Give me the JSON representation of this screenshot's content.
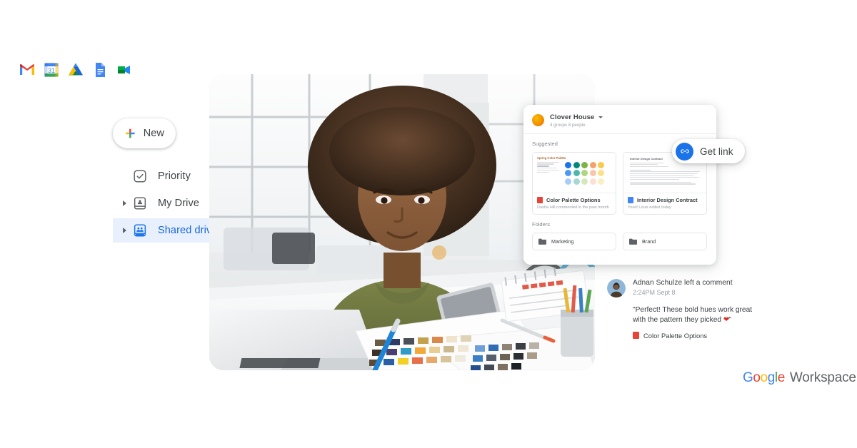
{
  "app_strip": [
    {
      "name": "gmail-icon",
      "label": "Gmail"
    },
    {
      "name": "calendar-icon",
      "label": "Calendar"
    },
    {
      "name": "drive-icon",
      "label": "Drive"
    },
    {
      "name": "docs-icon",
      "label": "Docs"
    },
    {
      "name": "meet-icon",
      "label": "Meet"
    }
  ],
  "sidebar": {
    "new_button": {
      "label": "New",
      "icon": "plus-icon"
    },
    "items": [
      {
        "label": "Priority",
        "icon": "priority-check-icon",
        "active": false,
        "expandable": false
      },
      {
        "label": "My Drive",
        "icon": "my-drive-icon",
        "active": false,
        "expandable": true
      },
      {
        "label": "Shared drives",
        "icon": "shared-drives-icon",
        "active": true,
        "expandable": true
      }
    ],
    "active_bg": "#e8f0fe",
    "active_fg": "#1967d2"
  },
  "drive_card": {
    "title": "Clover House",
    "subtitle": "4 groups  8 people",
    "dropdown_icon": "chevron-down-icon",
    "suggested_label": "Suggested",
    "files": [
      {
        "name": "Color Palette Options",
        "meta": "Dasha Hill commented in the past month",
        "type": "slides",
        "thumb_title": "Spring Color Palette"
      },
      {
        "name": "Interior Design Contract",
        "meta": "Yosef Louis edited today",
        "type": "docs",
        "thumb_title": "Interior Design Contract"
      }
    ],
    "folders_label": "Folders",
    "folders": [
      {
        "name": "Marketing"
      },
      {
        "name": "Brand"
      }
    ],
    "palette_colors": [
      [
        "#1a73e8",
        "#00897b",
        "#7cb342",
        "#f4a26b",
        "#f7cb4d"
      ],
      [
        "#4a9bf0",
        "#4db6ac",
        "#aed581",
        "#f9c6aa",
        "#fbe08a"
      ],
      [
        "#a8cdf7",
        "#a7d7d2",
        "#d4e8b8",
        "#fce0d2",
        "#fdeec2"
      ]
    ]
  },
  "get_link": {
    "label": "Get link",
    "icon": "link-icon",
    "color": "#1a73e8"
  },
  "comment": {
    "title": "Adnan Schulze left a comment",
    "timestamp": "2:24PM Sept 8",
    "quote_open": "\"Perfect! These bold hues work great with the pattern they picked ",
    "emoji": "❤",
    "quote_close": "\"",
    "chip_label": "Color Palette Options",
    "chip_icon": "slides-icon"
  },
  "logo": {
    "google_letters": [
      {
        "ch": "G",
        "color": "#4285f4"
      },
      {
        "ch": "o",
        "color": "#ea4335"
      },
      {
        "ch": "o",
        "color": "#fbbc04"
      },
      {
        "ch": "g",
        "color": "#4285f4"
      },
      {
        "ch": "l",
        "color": "#34a853"
      },
      {
        "ch": "e",
        "color": "#ea4335"
      }
    ],
    "workspace": "Workspace"
  },
  "photo": {
    "alt": "Designer reviewing color swatches at a desk with laptop"
  }
}
